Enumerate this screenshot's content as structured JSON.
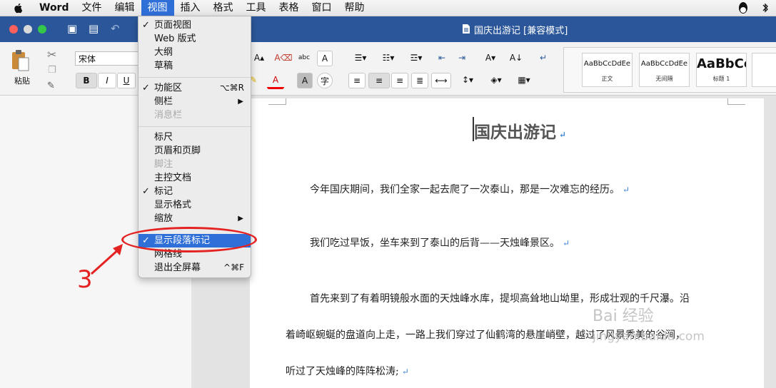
{
  "menubar": {
    "items": [
      "Word",
      "文件",
      "编辑",
      "视图",
      "插入",
      "格式",
      "工具",
      "表格",
      "窗口",
      "帮助"
    ]
  },
  "window": {
    "title": "国庆出游记 [兼容模式]"
  },
  "ribbon": {
    "paste_label": "粘贴",
    "font_name": "宋体",
    "bold": "B",
    "italic": "I",
    "underline": "U",
    "styles": [
      {
        "sample": "AaBbCcDdEe",
        "name": "正文"
      },
      {
        "sample": "AaBbCcDdEe",
        "name": "无间隔"
      },
      {
        "sample": "AaBbCc",
        "name": "标题 1"
      }
    ]
  },
  "view_menu": {
    "items": [
      {
        "label": "页面视图",
        "checked": true
      },
      {
        "label": "Web 版式",
        "checked": false
      },
      {
        "label": "大纲",
        "checked": false
      },
      {
        "label": "草稿",
        "checked": false
      },
      {
        "label": "功能区",
        "checked": true,
        "shortcut": "⌥⌘R"
      },
      {
        "label": "侧栏",
        "submenu": true
      },
      {
        "label": "消息栏",
        "disabled": true
      },
      {
        "label": "标尺"
      },
      {
        "label": "页眉和页脚"
      },
      {
        "label": "脚注",
        "disabled": true
      },
      {
        "label": "主控文档"
      },
      {
        "label": "标记",
        "checked": true
      },
      {
        "label": "显示格式"
      },
      {
        "label": "缩放",
        "submenu": true
      },
      {
        "label": "显示段落标记",
        "checked": true,
        "highlighted": true
      },
      {
        "label": "网格线"
      },
      {
        "label": "退出全屏幕",
        "shortcut": "^⌘F"
      }
    ]
  },
  "annotation": {
    "step": "3"
  },
  "document": {
    "heading": "国庆出游记",
    "paragraphs": [
      "今年国庆期间，我们全家一起去爬了一次泰山，那是一次难忘的经历。",
      "我们吃过早饭，坐车来到了泰山的后背——天烛峰景区。",
      "首先来到了有着明镜般水面的天烛峰水库，提坝高耸地山坳里，形成壮观的千尺瀑。沿",
      "着崎岖蜿蜒的盘道向上走，一路上我们穿过了仙鹤湾的悬崖峭壁，越过了风景秀美的谷涧，",
      "听过了天烛峰的阵阵松涛;"
    ],
    "paragraph_mark": "↵"
  },
  "watermark": {
    "text": "Bai 经验",
    "url": "jingyan.baidu.com"
  },
  "colors": {
    "accent": "#2b579a",
    "menu_highlight": "#2f6fd8",
    "annotation": "#e52222"
  }
}
